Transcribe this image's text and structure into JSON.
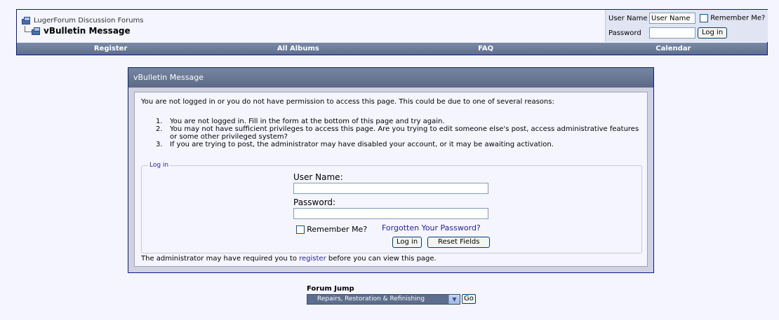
{
  "breadcrumb": {
    "forum_name": "LugerForum Discussion Forums",
    "page_title": "vBulletin Message"
  },
  "header_login": {
    "username_label": "User Name",
    "username_value": "User Name",
    "remember_label": "Remember Me?",
    "password_label": "Password",
    "login_button": "Log in"
  },
  "navbar": {
    "items": [
      "Register",
      "All Albums",
      "FAQ",
      "Calendar"
    ]
  },
  "message": {
    "title": "vBulletin Message",
    "intro": "You are not logged in or you do not have permission to access this page. This could be due to one of several reasons:",
    "reasons": [
      {
        "num": "1.",
        "lines": [
          "You are not logged in. Fill in the form at the bottom of this page and try again."
        ]
      },
      {
        "num": "2.",
        "lines": [
          "You may not have sufficient privileges to access this page. Are you trying to edit someone else's post, access administrative features",
          "or some other privileged system?"
        ]
      },
      {
        "num": "3.",
        "lines": [
          "If you are trying to post, the administrator may have disabled your account, or it may be awaiting activation."
        ]
      }
    ],
    "login_legend": "Log in",
    "username_label": "User Name:",
    "password_label": "Password:",
    "remember_label": "Remember Me?",
    "forgot_link": "Forgotten Your Password?",
    "login_button": "Log in",
    "reset_button": "Reset Fields",
    "footnote_before": "The administrator may have required you to ",
    "footnote_link": "register",
    "footnote_after": " before you can view this page."
  },
  "forum_jump": {
    "title": "Forum Jump",
    "selected": "Repairs, Restoration & Refinishing",
    "go_button": "Go"
  },
  "colors": {
    "navbar": "#5e6f8e",
    "border": "#0b198c",
    "link": "#22229c",
    "page_bg": "#f5f5ff"
  }
}
